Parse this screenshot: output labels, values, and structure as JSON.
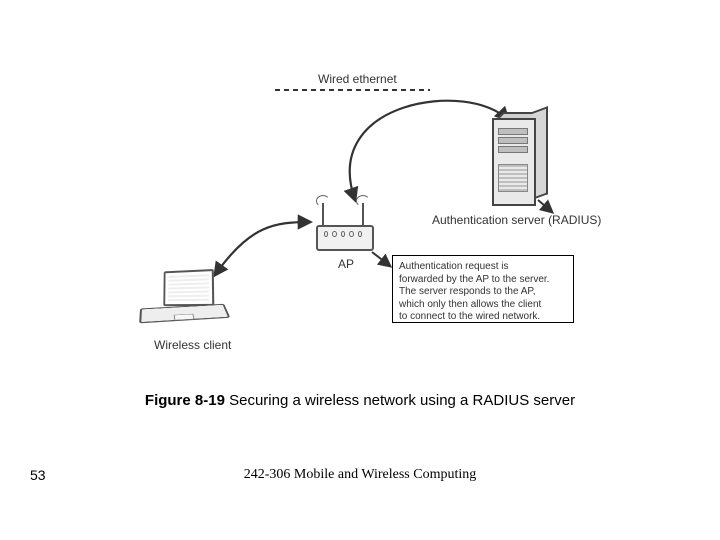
{
  "labels": {
    "wired_ethernet": "Wired ethernet",
    "auth_server": "Authentication server (RADIUS)",
    "ap": "AP",
    "wireless_client": "Wireless client"
  },
  "caption_box": {
    "l1": "Authentication request is",
    "l2": "forwarded by the AP to the server.",
    "l3": "The server responds to the AP,",
    "l4": "which only then allows the client",
    "l5": "to connect to the wired network."
  },
  "figure": {
    "number": "Figure 8-19",
    "title": "Securing a wireless network using a RADIUS server"
  },
  "footer": {
    "page": "53",
    "course": "242-306 Mobile and Wireless Computing"
  }
}
